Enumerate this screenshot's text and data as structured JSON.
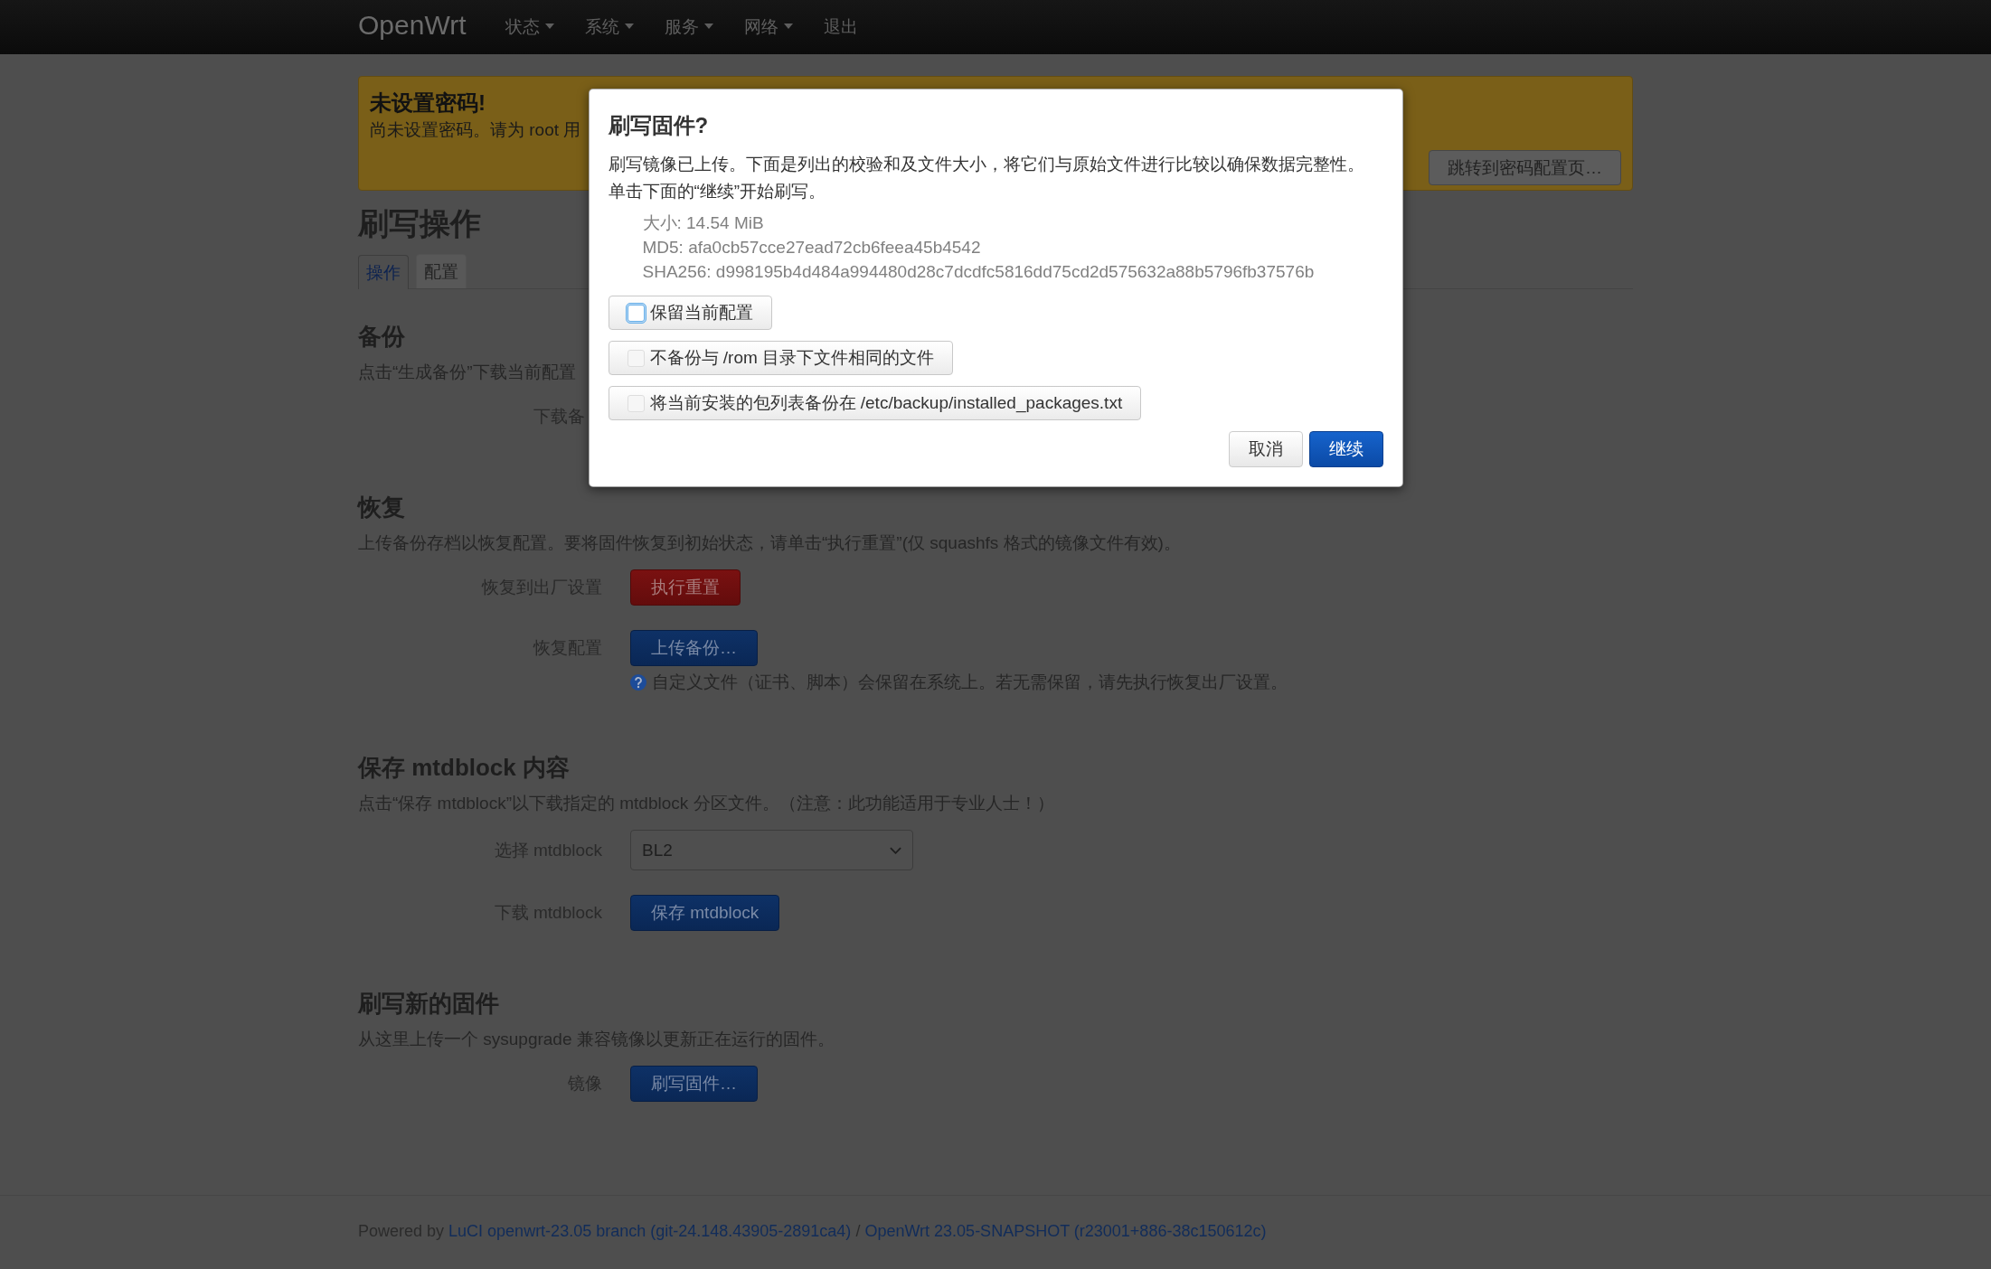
{
  "navbar": {
    "brand": "OpenWrt",
    "items": [
      {
        "label": "状态",
        "dropdown": true
      },
      {
        "label": "系统",
        "dropdown": true
      },
      {
        "label": "服务",
        "dropdown": true
      },
      {
        "label": "网络",
        "dropdown": true
      },
      {
        "label": "退出",
        "dropdown": false
      }
    ]
  },
  "alert": {
    "title": "未设置密码!",
    "text": "尚未设置密码。请为 root 用",
    "button": "跳转到密码配置页…"
  },
  "page": {
    "title": "刷写操作",
    "tabs": [
      {
        "label": "操作",
        "selected": true
      },
      {
        "label": "配置",
        "selected": false
      }
    ]
  },
  "sections": [
    {
      "title": "备份",
      "description": "点击“生成备份”下载当前配置",
      "rows": [
        {
          "kind": "covered",
          "label": "下载备"
        }
      ]
    },
    {
      "title": "恢复",
      "description": "上传备份存档以恢复配置。要将固件恢复到初始状态，请单击“执行重置”(仅 squashfs 格式的镜像文件有效)。",
      "rows": [
        {
          "kind": "button",
          "label": "恢复到出厂设置",
          "button": {
            "label": "执行重置",
            "kind": "negative"
          }
        },
        {
          "kind": "button",
          "label": "恢复配置",
          "button": {
            "label": "上传备份…",
            "kind": "action"
          },
          "help": "自定义文件（证书、脚本）会保留在系统上。若无需保留，请先执行恢复出厂设置。"
        }
      ]
    },
    {
      "title": "保存 mtdblock 内容",
      "description": "点击“保存 mtdblock”以下载指定的 mtdblock 分区文件。（注意：此功能适用于专业人士！）",
      "rows": [
        {
          "kind": "select",
          "label": "选择 mtdblock",
          "value": "BL2"
        },
        {
          "kind": "button",
          "label": "下载 mtdblock",
          "button": {
            "label": "保存 mtdblock",
            "kind": "action"
          }
        }
      ]
    },
    {
      "title": "刷写新的固件",
      "description": "从这里上传一个 sysupgrade 兼容镜像以更新正在运行的固件。",
      "rows": [
        {
          "kind": "button",
          "label": "镜像",
          "button": {
            "label": "刷写固件…",
            "kind": "action"
          }
        }
      ]
    }
  ],
  "footer": {
    "parts": [
      {
        "kind": "text",
        "text": "Powered by"
      },
      {
        "kind": "link",
        "text": "LuCI openwrt-23.05 branch (git-24.148.43905-2891ca4)"
      },
      {
        "kind": "text",
        "text": "/"
      },
      {
        "kind": "link",
        "text": "OpenWrt 23.05-SNAPSHOT (r23001+886-38c150612c)"
      }
    ]
  },
  "dialog": {
    "title": "刷写固件?",
    "text": [
      "刷写镜像已上传。下面是列出的校验和及文件大小，将它们与原始文件进行比较以确保数据完整性。",
      "单击下面的“继续”开始刷写。"
    ],
    "details": [
      "大小: 14.54 MiB",
      "MD5: afa0cb57cce27ead72cb6feea45b4542",
      "SHA256: d998195b4d484a994480d28c7dcdfc5816dd75cd2d575632a88b5796fb37576b"
    ],
    "options": [
      {
        "label": "保留当前配置",
        "checked": false,
        "focused": true
      },
      {
        "label": "不备份与 /rom 目录下文件相同的文件",
        "checked": false,
        "focused": false
      },
      {
        "label": "将当前安装的包列表备份在 /etc/backup/installed_packages.txt",
        "checked": false,
        "focused": false
      }
    ],
    "buttons": [
      {
        "label": "取消",
        "kind": "neutral"
      },
      {
        "label": "继续",
        "kind": "primary"
      }
    ]
  }
}
